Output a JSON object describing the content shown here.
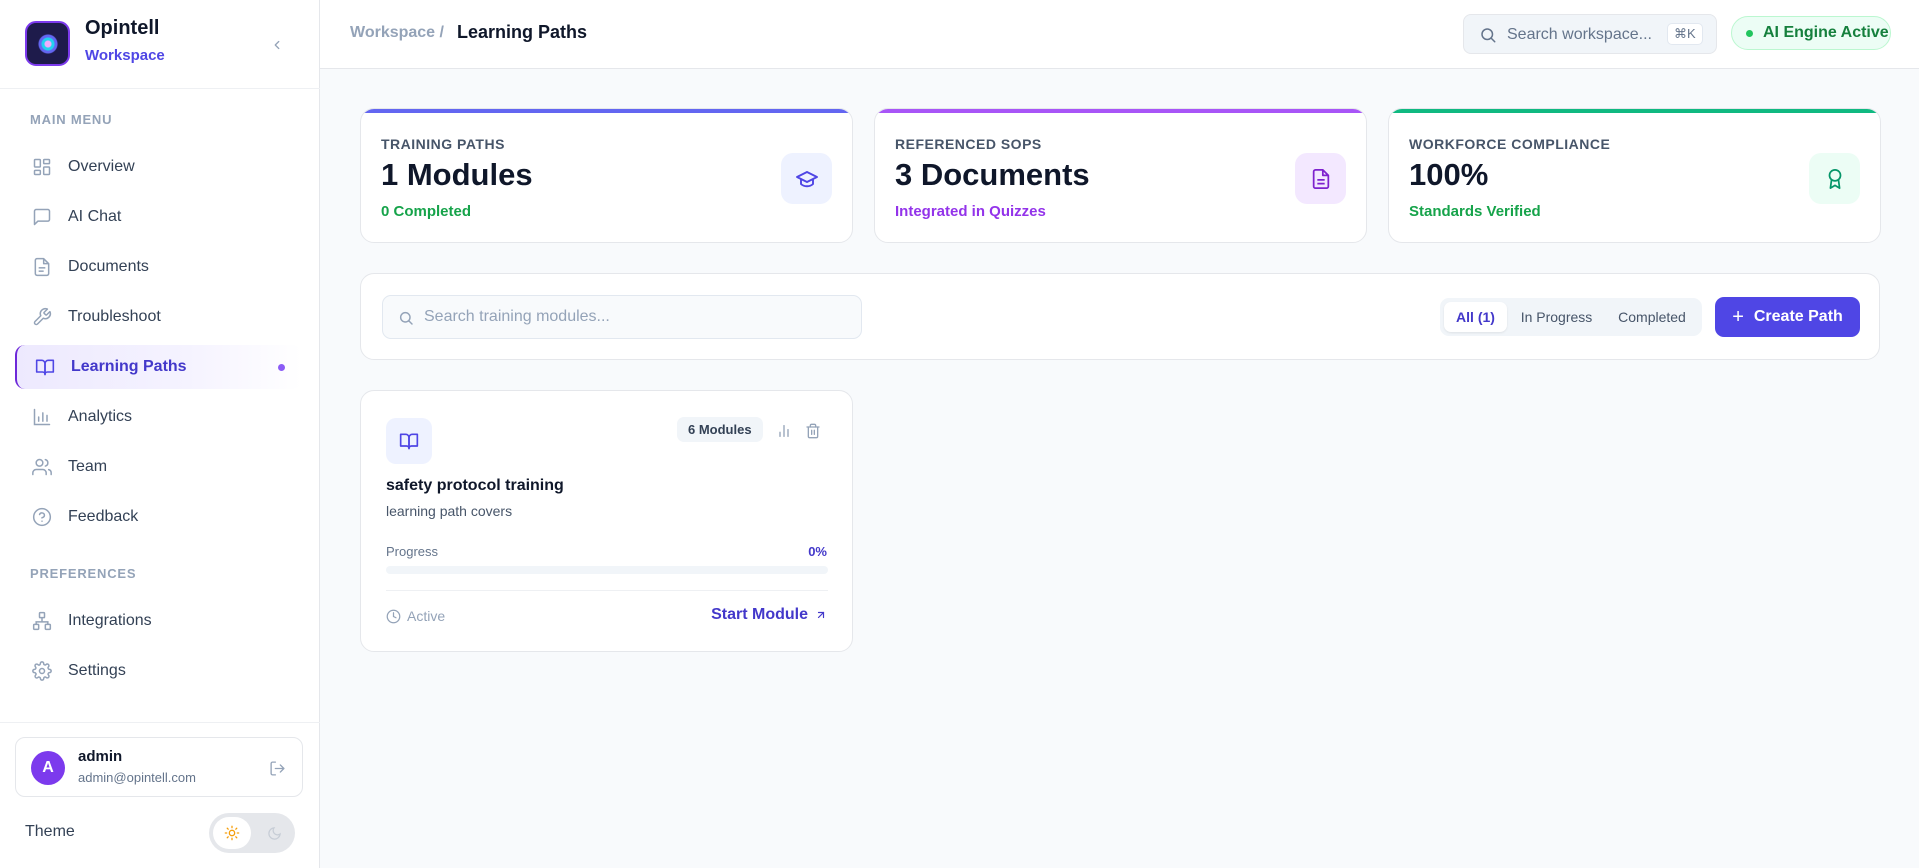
{
  "brand": {
    "name": "Opintell",
    "subtitle": "Workspace"
  },
  "sidebar": {
    "main_menu_label": "MAIN MENU",
    "preferences_label": "PREFERENCES",
    "items": [
      {
        "label": "Overview",
        "icon": "grid-icon"
      },
      {
        "label": "AI Chat",
        "icon": "chat-icon"
      },
      {
        "label": "Documents",
        "icon": "document-icon"
      },
      {
        "label": "Troubleshoot",
        "icon": "wrench-icon"
      },
      {
        "label": "Learning Paths",
        "icon": "book-icon",
        "active": true
      },
      {
        "label": "Analytics",
        "icon": "bar-chart-icon"
      },
      {
        "label": "Team",
        "icon": "users-icon"
      },
      {
        "label": "Feedback",
        "icon": "help-circle-icon"
      }
    ],
    "pref_items": [
      {
        "label": "Integrations",
        "icon": "network-icon"
      },
      {
        "label": "Settings",
        "icon": "gear-icon"
      }
    ]
  },
  "user": {
    "initial": "A",
    "name": "admin",
    "email": "admin@opintell.com"
  },
  "theme": {
    "label": "Theme",
    "selected": "light"
  },
  "header": {
    "breadcrumb_root": "Workspace /",
    "breadcrumb_current": "Learning Paths",
    "search_placeholder": "Search workspace...",
    "search_shortcut": "⌘K",
    "ai_status": "AI Engine Active"
  },
  "stats": [
    {
      "label": "TRAINING PATHS",
      "value": "1 Modules",
      "sub": "0 Completed",
      "accent": "#6366f1",
      "sub_color": "#16a34a",
      "icon": "graduation-cap-icon"
    },
    {
      "label": "REFERENCED SOPS",
      "value": "3 Documents",
      "sub": "Integrated in Quizzes",
      "accent": "#a855f7",
      "sub_color": "#9333ea",
      "icon": "file-text-icon"
    },
    {
      "label": "WORKFORCE COMPLIANCE",
      "value": "100%",
      "sub": "Standards Verified",
      "accent": "#10b981",
      "sub_color": "#16a34a",
      "icon": "award-icon"
    }
  ],
  "filters": {
    "search_placeholder": "Search training modules...",
    "tabs": [
      "All (1)",
      "In Progress",
      "Completed"
    ],
    "active_tab": "All (1)",
    "create_label": "Create Path"
  },
  "path_card": {
    "badge": "6 Modules",
    "title": "safety protocol training",
    "description": "learning path covers",
    "progress_label": "Progress",
    "progress_text": "0%",
    "progress_value": 0,
    "status": "Active",
    "action_label": "Start Module"
  }
}
